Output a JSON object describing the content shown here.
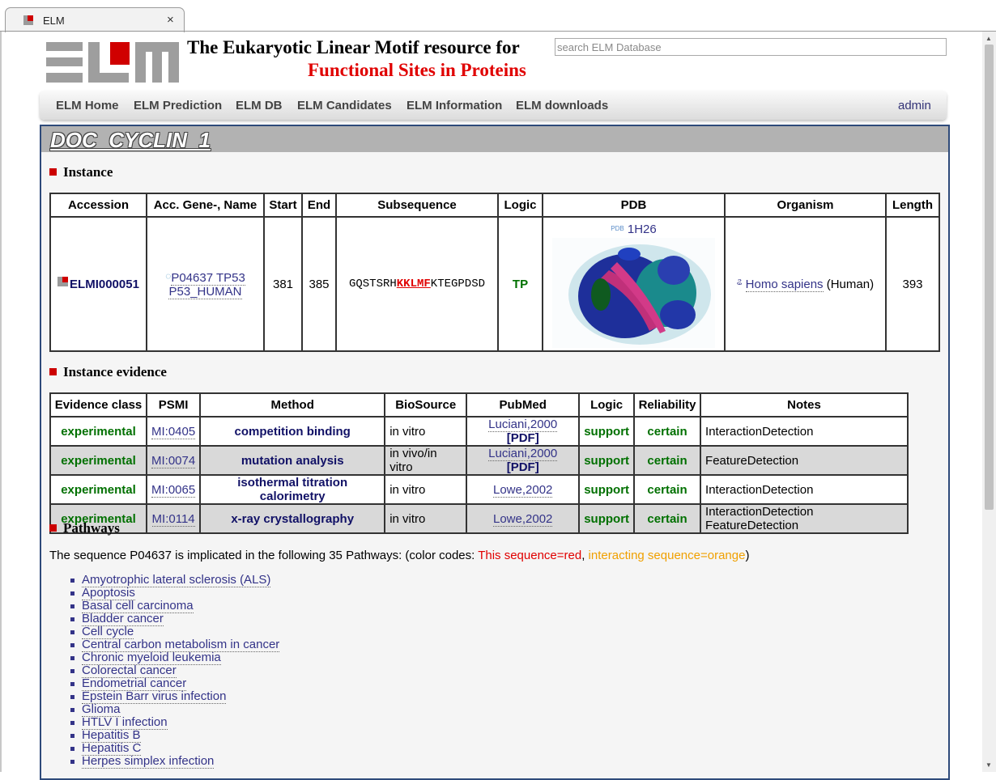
{
  "browser": {
    "tab_title": "ELM",
    "tab_close": "×"
  },
  "header": {
    "title_line1": "The Eukaryotic Linear Motif resource for",
    "title_line2": "Functional Sites in Proteins",
    "search_placeholder": "search ELM Database"
  },
  "nav": {
    "items": [
      "ELM Home",
      "ELM Prediction",
      "ELM DB",
      "ELM Candidates",
      "ELM Information",
      "ELM downloads"
    ],
    "admin": "admin"
  },
  "page": {
    "title": "DOC_CYCLIN_1"
  },
  "instance": {
    "heading": "Instance",
    "headers": [
      "Accession",
      "Acc. Gene-, Name",
      "Start",
      "End",
      "Subsequence",
      "Logic",
      "PDB",
      "Organism",
      "Length"
    ],
    "accession": "ELMI000051",
    "gene_acc": "P04637 TP53",
    "gene_name": "P53_HUMAN",
    "start": "381",
    "end": "385",
    "subseq_pre": "GQSTSRH",
    "subseq_motif": "KKLMF",
    "subseq_post": "KTEGPDSD",
    "logic": "TP",
    "pdb_id": "1H26",
    "organism": "Homo sapiens",
    "organism_common": "(Human)",
    "length": "393"
  },
  "evidence": {
    "heading": "Instance evidence",
    "headers": [
      "Evidence class",
      "PSMI",
      "Method",
      "BioSource",
      "PubMed",
      "Logic",
      "Reliability",
      "Notes"
    ],
    "rows": [
      {
        "cls": "experimental",
        "psmi": "MI:0405",
        "method": "competition binding",
        "bio": "in vitro",
        "pub": "Luciani,2000",
        "pdf": "[PDF]",
        "logic": "support",
        "rel": "certain",
        "notes": "InteractionDetection"
      },
      {
        "cls": "experimental",
        "psmi": "MI:0074",
        "method": "mutation analysis",
        "bio": "in vivo/in vitro",
        "pub": "Luciani,2000",
        "pdf": "[PDF]",
        "logic": "support",
        "rel": "certain",
        "notes": "FeatureDetection"
      },
      {
        "cls": "experimental",
        "psmi": "MI:0065",
        "method": "isothermal titration calorimetry",
        "bio": "in vitro",
        "pub": "Lowe,2002",
        "pdf": "",
        "logic": "support",
        "rel": "certain",
        "notes": "InteractionDetection"
      },
      {
        "cls": "experimental",
        "psmi": "MI:0114",
        "method": "x-ray crystallography",
        "bio": "in vitro",
        "pub": "Lowe,2002",
        "pdf": "",
        "logic": "support",
        "rel": "certain",
        "notes": "InteractionDetection FeatureDetection"
      }
    ]
  },
  "pathways": {
    "heading": "Pathways",
    "intro": "The sequence P04637 is implicated in the following 35 Pathways: (color codes: ",
    "red_code": "This sequence=red",
    "sep": ", ",
    "orange_code": "interacting sequence=orange",
    "close": ")",
    "items": [
      "Amyotrophic lateral sclerosis (ALS)",
      "Apoptosis",
      "Basal cell carcinoma",
      "Bladder cancer",
      "Cell cycle",
      "Central carbon metabolism in cancer",
      "Chronic myeloid leukemia",
      "Colorectal cancer",
      "Endometrial cancer",
      "Epstein Barr virus infection",
      "Glioma",
      "HTLV I infection",
      "Hepatitis B",
      "Hepatitis C",
      "Herpes simplex infection"
    ]
  },
  "colors": {
    "motif_red": "#e00000",
    "evidence_green": "#007000",
    "link_blue": "#333388",
    "panel_border": "#2e4a7a"
  }
}
